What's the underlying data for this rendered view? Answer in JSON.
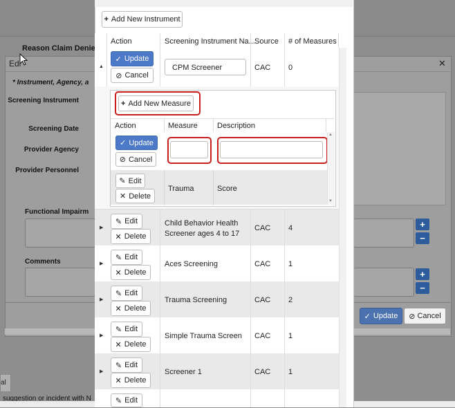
{
  "background": {
    "reason_label": "Reason Claim Denie",
    "dialog_title": "Edi",
    "required_note": "* Instrument, Agency, a",
    "labels": {
      "screening_instrument": "Screening Instrument",
      "screening_date": "Screening Date",
      "provider_agency": "Provider Agency",
      "provider_personnel": "Provider Personnel",
      "functional_impairment": "Functional Impairm",
      "comments": "Comments"
    },
    "update_label": "Update",
    "cancel_label": "Cancel",
    "bottom_left_text": "al",
    "bottom_suggest_text": "suggestion or incident with N"
  },
  "modal": {
    "add_instrument_label": "Add New Instrument",
    "columns": [
      "Action",
      "Screening Instrument Na...",
      "Source",
      "# of Measures"
    ],
    "editing_row": {
      "update_label": "Update",
      "cancel_label": "Cancel",
      "instrument_value": "CPM Screener",
      "source": "CAC",
      "measures": "0"
    },
    "measures_sub": {
      "add_measure_label": "Add New Measure",
      "columns": [
        "Action",
        "Measure",
        "Description"
      ],
      "editing_row": {
        "update_label": "Update",
        "cancel_label": "Cancel",
        "measure_value": "",
        "description_value": ""
      },
      "rows": [
        {
          "edit_label": "Edit",
          "delete_label": "Delete",
          "measure": "Trauma",
          "description": "Score"
        }
      ]
    },
    "rows": [
      {
        "name_line1": "Child Behavior Health",
        "name_line2": "Screener ages 4 to 17",
        "source": "CAC",
        "measures": "4",
        "edit_label": "Edit",
        "delete_label": "Delete"
      },
      {
        "name_line1": "Aces Screening",
        "name_line2": "",
        "source": "CAC",
        "measures": "1",
        "edit_label": "Edit",
        "delete_label": "Delete"
      },
      {
        "name_line1": "Trauma Screening",
        "name_line2": "",
        "source": "CAC",
        "measures": "2",
        "edit_label": "Edit",
        "delete_label": "Delete"
      },
      {
        "name_line1": "Simple Trauma Screen",
        "name_line2": "",
        "source": "CAC",
        "measures": "1",
        "edit_label": "Edit",
        "delete_label": "Delete"
      },
      {
        "name_line1": "Screener 1",
        "name_line2": "",
        "source": "CAC",
        "measures": "1",
        "edit_label": "Edit",
        "delete_label": "Delete"
      },
      {
        "edit_label": "Edit"
      }
    ]
  },
  "colors": {
    "primary": "#4d79c9",
    "highlight": "#cc1d1d",
    "row_alt": "#e9e9e9"
  },
  "icons": [
    "plus-icon",
    "check-icon",
    "ban-icon",
    "pencil-icon",
    "times-icon",
    "caret-right-icon",
    "caret-down-icon",
    "close-icon"
  ]
}
